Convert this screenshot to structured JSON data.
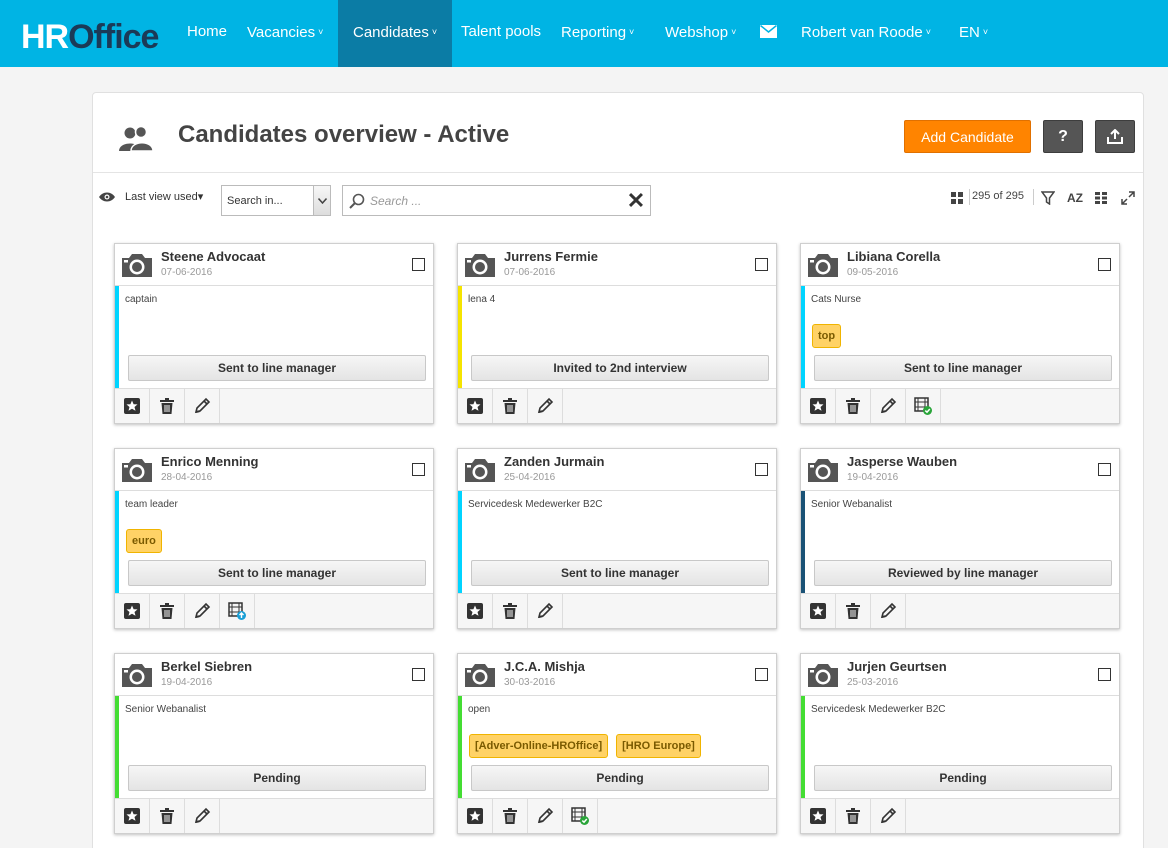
{
  "nav": {
    "logo_h": "HR",
    "logo_office": "Office",
    "items": [
      {
        "label": "Home",
        "has_caret": false
      },
      {
        "label": "Vacancies",
        "has_caret": true
      },
      {
        "label": "Candidates",
        "has_caret": true,
        "active": true
      },
      {
        "label": "Talent pools",
        "has_caret": false
      },
      {
        "label": "Reporting",
        "has_caret": true
      },
      {
        "label": "Webshop",
        "has_caret": true
      },
      {
        "label": "Robert van Roode",
        "has_caret": true
      },
      {
        "label": "EN",
        "has_caret": true
      }
    ],
    "caret": "˅",
    "mail_icon": "envelope-icon"
  },
  "header": {
    "title": "Candidates overview - Active",
    "add_button": "Add Candidate",
    "help_button": "?",
    "export_icon": "export-icon"
  },
  "toolbar": {
    "last_view": "Last view used▾",
    "search_in": "Search in...",
    "search_placeholder": "Search ...",
    "count": "295 of 295",
    "sort_label": "AZ"
  },
  "candidates": [
    {
      "name": "Steene Advocaat",
      "date": "07-06-2016",
      "job": "captain",
      "tags": [],
      "status": "Sent to line manager",
      "color": "#00d4ff",
      "video": ""
    },
    {
      "name": "Jurrens Fermie",
      "date": "07-06-2016",
      "job": "lena 4",
      "tags": [],
      "status": "Invited to 2nd interview",
      "color": "#f5e400",
      "video": ""
    },
    {
      "name": "Libiana Corella",
      "date": "09-05-2016",
      "job": "Cats Nurse",
      "tags": [
        "top"
      ],
      "status": "Sent to line manager",
      "color": "#00d4ff",
      "video": "check"
    },
    {
      "name": "Enrico Menning",
      "date": "28-04-2016",
      "job": "team leader",
      "tags": [
        "euro"
      ],
      "status": "Sent to line manager",
      "color": "#00d4ff",
      "video": "upload"
    },
    {
      "name": "Zanden Jurmain",
      "date": "25-04-2016",
      "job": "Servicedesk Medewerker B2C",
      "tags": [],
      "status": "Sent to line manager",
      "color": "#00d4ff",
      "video": ""
    },
    {
      "name": "Jasperse Wauben",
      "date": "19-04-2016",
      "job": "Senior Webanalist",
      "tags": [],
      "status": "Reviewed by line manager",
      "color": "#1a5276",
      "video": ""
    },
    {
      "name": "Berkel Siebren",
      "date": "19-04-2016",
      "job": "Senior Webanalist",
      "tags": [],
      "status": "Pending",
      "color": "#44dd33",
      "video": ""
    },
    {
      "name": "J.C.A. Mishja",
      "date": "30-03-2016",
      "job": "open",
      "tags": [
        "[Adver-Online-HROffice]",
        "[HRO Europe]"
      ],
      "status": "Pending",
      "color": "#44dd33",
      "video": "check"
    },
    {
      "name": "Jurjen Geurtsen",
      "date": "25-03-2016",
      "job": "Servicedesk Medewerker B2C",
      "tags": [],
      "status": "Pending",
      "color": "#44dd33",
      "video": ""
    }
  ]
}
